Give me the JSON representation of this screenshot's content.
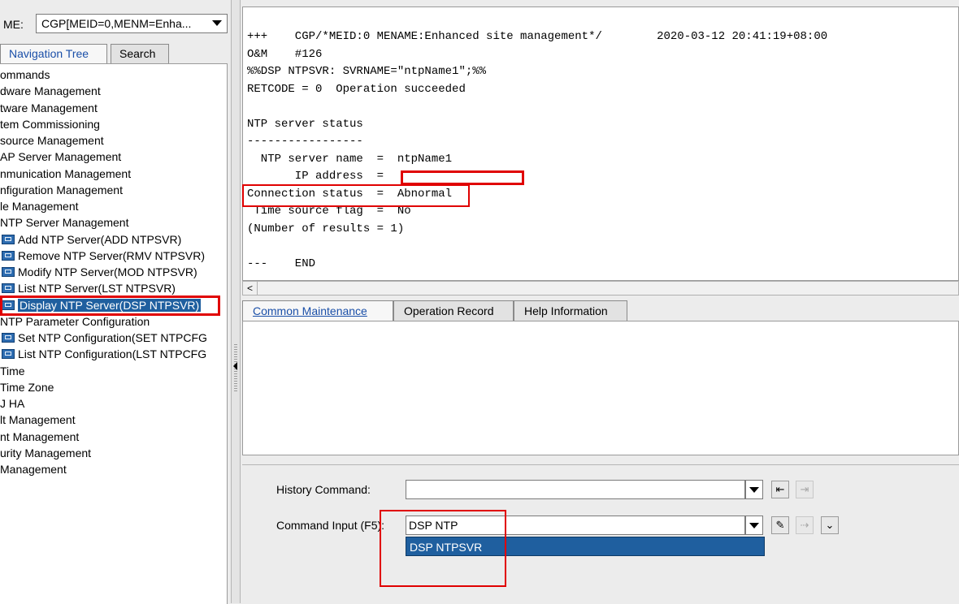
{
  "left_panel": {
    "me_label": "ME:",
    "me_select_value": "CGP[MEID=0,MENM=Enha...",
    "tabs": {
      "nav": "Navigation Tree",
      "search": "Search"
    },
    "tree": [
      {
        "label": "ommands",
        "icon": false
      },
      {
        "label": "dware Management",
        "icon": false
      },
      {
        "label": "tware Management",
        "icon": false
      },
      {
        "label": "tem Commissioning",
        "icon": false
      },
      {
        "label": "source Management",
        "icon": false
      },
      {
        "label": "AP Server Management",
        "icon": false
      },
      {
        "label": "nmunication Management",
        "icon": false
      },
      {
        "label": "nfiguration Management",
        "icon": false
      },
      {
        "label": "le Management",
        "icon": false
      },
      {
        "label": "NTP Server Management",
        "icon": false
      },
      {
        "label": "Add NTP Server(ADD NTPSVR)",
        "icon": true
      },
      {
        "label": "Remove NTP Server(RMV NTPSVR)",
        "icon": true
      },
      {
        "label": "Modify NTP Server(MOD NTPSVR)",
        "icon": true
      },
      {
        "label": "List NTP Server(LST NTPSVR)",
        "icon": true
      },
      {
        "label": "Display NTP Server(DSP NTPSVR)",
        "icon": true,
        "selected": true
      },
      {
        "label": "NTP Parameter Configuration",
        "icon": false
      },
      {
        "label": "Set NTP Configuration(SET NTPCFG",
        "icon": true
      },
      {
        "label": "List NTP Configuration(LST NTPCFG",
        "icon": true
      },
      {
        "label": "Time",
        "icon": false
      },
      {
        "label": "Time Zone",
        "icon": false
      },
      {
        "label": "J HA",
        "icon": false
      },
      {
        "label": "lt Management",
        "icon": false
      },
      {
        "label": "nt Management",
        "icon": false
      },
      {
        "label": "urity Management",
        "icon": false
      },
      {
        "label": "Management",
        "icon": false
      }
    ]
  },
  "output": {
    "lines": [
      "+++    CGP/*MEID:0 MENAME:Enhanced site management*/        2020-03-12 20:41:19+08:00",
      "O&M    #126",
      "%%DSP NTPSVR: SVRNAME=\"ntpName1\";%%",
      "RETCODE = 0  Operation succeeded",
      "",
      "NTP server status",
      "-----------------",
      "  NTP server name  =  ntpName1",
      "       IP address  =",
      "Connection status  =  Abnormal",
      " Time source flag  =  No",
      "(Number of results = 1)",
      "",
      "---    END"
    ],
    "scroll_left": "<"
  },
  "bottom_tabs": {
    "common": "Common Maintenance",
    "oprec": "Operation Record",
    "help": "Help Information"
  },
  "command": {
    "history_label": "History Command:",
    "history_value": "",
    "input_label": "Command Input (F5):",
    "input_value": "DSP NTP",
    "suggestion": "DSP NTPSVR"
  },
  "colors": {
    "highlight_red": "#e00000",
    "selection_blue": "#1f5f9f",
    "link_blue": "#1a4fa8"
  }
}
